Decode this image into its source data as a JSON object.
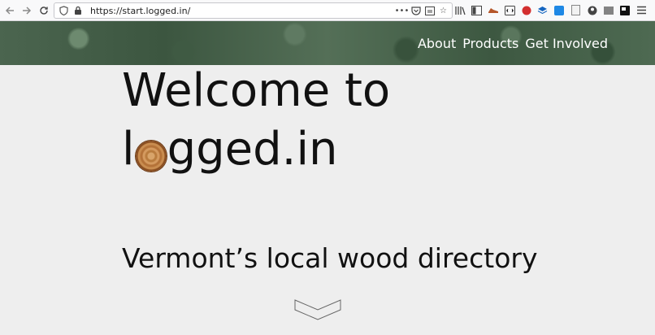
{
  "browser": {
    "url": "https://start.logged.in/",
    "icons": {
      "back": "arrow-left-icon",
      "forward": "arrow-right-icon",
      "reload": "reload-icon",
      "shield": "shield-icon",
      "lock": "lock-icon",
      "page_actions": "more-icon",
      "pocket": "pocket-icon",
      "reader": "reader-icon",
      "bookmark": "star-icon"
    }
  },
  "nav": {
    "items": [
      "About",
      "Products",
      "Get Involved"
    ]
  },
  "hero": {
    "title_line1": "Welcome to",
    "title_prefix": "l",
    "title_suffix": "gged.in",
    "subtitle": "Vermont’s local wood directory"
  },
  "colors": {
    "page_background": "#eeeeee",
    "header_green": "#4b654f",
    "text": "#111111"
  }
}
